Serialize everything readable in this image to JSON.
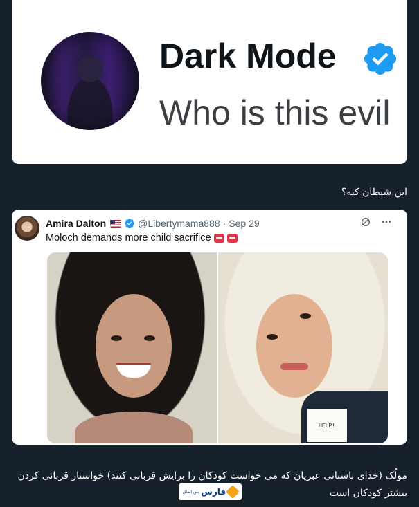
{
  "tweet_zoom": {
    "name": "Dark Mode",
    "text": "Who is this evil"
  },
  "message": {
    "caption": "این شیطان کیه؟"
  },
  "tweet": {
    "name": "Amira Dalton",
    "handle": "@Libertymama888",
    "separator": "·",
    "date": "Sep 29",
    "text": "Moloch demands more child sacrifice",
    "help_card_text": "HELP!"
  },
  "footer": {
    "caption": "مولُک (خدای باستانی عبریان که می خواست کودکان را برایش قربانی کنند) خواستار قربانی کردن بیشتر کودکان است",
    "logo_text": "فارس",
    "logo_sub": "بین الملل"
  },
  "colors": {
    "background": "#17212b",
    "verified": "#1d9bf0",
    "logo_accent": "#f5a21b"
  }
}
